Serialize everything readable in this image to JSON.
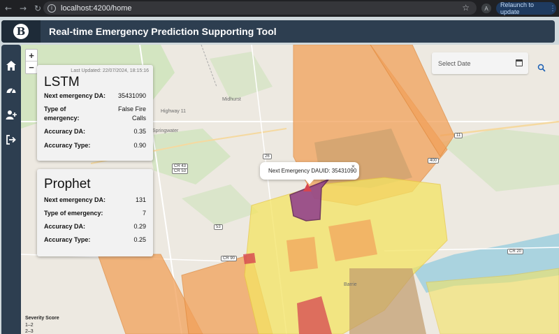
{
  "browser": {
    "url": "localhost:4200/home",
    "profile_initial": "A",
    "relaunch_label": "Relaunch to update"
  },
  "app": {
    "title": "Real-time Emergency Prediction Supporting Tool",
    "logo_letter": "B"
  },
  "lstm": {
    "updated": "Last Updated: 22/07/2024, 18:15:16",
    "title": "LSTM",
    "rows": [
      {
        "label": "Next emergency DA:",
        "value": "35431090"
      },
      {
        "label": "Type of emergency:",
        "value": "False Fire Calls"
      },
      {
        "label": "Accuracy DA:",
        "value": "0.35"
      },
      {
        "label": "Accuracy Type:",
        "value": "0.90"
      }
    ]
  },
  "prophet": {
    "title": "Prophet",
    "rows": [
      {
        "label": "Next emergency DA:",
        "value": "131"
      },
      {
        "label": "Type of emergency:",
        "value": "7"
      },
      {
        "label": "Accuracy DA:",
        "value": "0.29"
      },
      {
        "label": "Accuracy Type:",
        "value": "0.25"
      }
    ]
  },
  "date_picker": {
    "placeholder": "Select Date"
  },
  "popup": {
    "text": "Next Emergency DAUID: 35431090",
    "close": "×"
  },
  "zoom": {
    "in": "+",
    "out": "−"
  },
  "legend": {
    "title": "Severity Score",
    "items": [
      "1–2",
      "2–3"
    ]
  },
  "map_labels": {
    "midhurst": "Midhurst",
    "barrie": "Barrie",
    "springwater": "Springwater",
    "highway11": "Highway 11",
    "cr43": "CR 43",
    "cr53": "CR 53",
    "r26": "26",
    "r53": "53",
    "r400": "400",
    "cr20": "CR 20",
    "cr90": "CR 90",
    "r11": "11"
  },
  "colors": {
    "header": "#2d3e50",
    "selected_region": "#8e3a8c",
    "severity_low": "#f4e463",
    "severity_mid": "#f2a15a",
    "severity_high": "#d64550",
    "water": "#aad3df"
  }
}
